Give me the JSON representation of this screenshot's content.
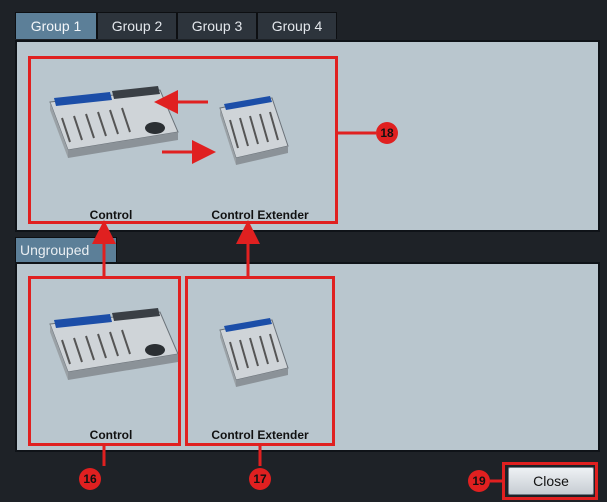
{
  "tabs": [
    {
      "label": "Group 1"
    },
    {
      "label": "Group 2"
    },
    {
      "label": "Group 3"
    },
    {
      "label": "Group 4"
    }
  ],
  "group_panel": {
    "devices": [
      {
        "label": "Control"
      },
      {
        "label": "Control Extender"
      }
    ]
  },
  "ungrouped_panel": {
    "tab_label": "Ungrouped",
    "devices": [
      {
        "label": "Control"
      },
      {
        "label": "Control Extender"
      }
    ]
  },
  "callouts": {
    "group": "18",
    "control": "16",
    "extender": "17",
    "close": "19"
  },
  "close_label": "Close",
  "colors": {
    "accent": "#e02020",
    "panel": "#b9c6ce",
    "tab_active": "#5c7f98",
    "background": "#1e2227"
  }
}
